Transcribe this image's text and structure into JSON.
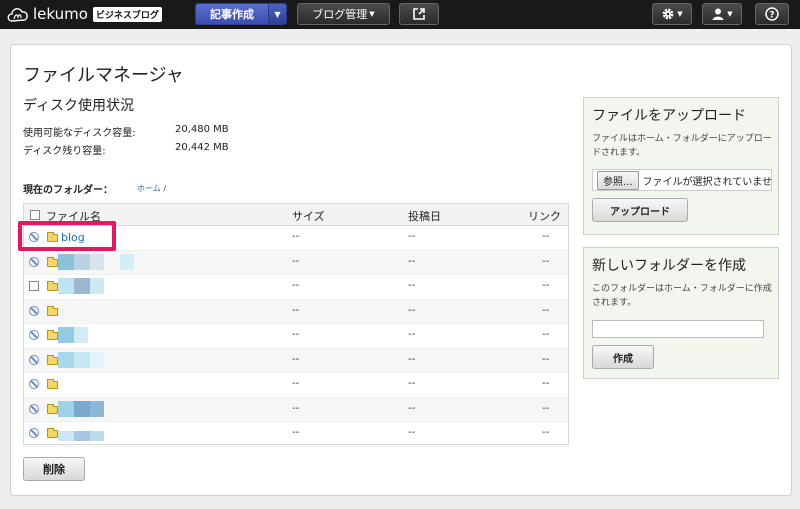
{
  "topbar": {
    "logo_text": "lekumo",
    "logo_badge": "ビジネスブログ",
    "post_label": "記事作成",
    "blog_manage_label": "ブログ管理",
    "icons": [
      "external-link-icon",
      "gear-icon",
      "user-icon",
      "help-icon"
    ]
  },
  "page": {
    "title": "ファイルマネージャ",
    "disk_title": "ディスク使用状況",
    "disk": [
      {
        "label": "使用可能なディスク容量:",
        "value": "20,480 MB"
      },
      {
        "label": "ディスク残り容量:",
        "value": "20,442 MB"
      }
    ],
    "folder_label": "現在のフォルダー：",
    "breadcrumb": "ホーム",
    "breadcrumb_sep": "/"
  },
  "table": {
    "headers": {
      "name": "ファイル名",
      "size": "サイズ",
      "date": "投稿日",
      "link": "リンク"
    },
    "rows": [
      {
        "name": "blog",
        "size": "--",
        "date": "--",
        "link": "--"
      },
      {
        "name": "",
        "size": "--",
        "date": "--",
        "link": "--"
      },
      {
        "name": "",
        "size": "--",
        "date": "--",
        "link": "--"
      },
      {
        "name": "",
        "size": "--",
        "date": "--",
        "link": "--"
      },
      {
        "name": "",
        "size": "--",
        "date": "--",
        "link": "--"
      },
      {
        "name": "",
        "size": "--",
        "date": "--",
        "link": "--"
      },
      {
        "name": "",
        "size": "--",
        "date": "--",
        "link": "--"
      },
      {
        "name": "",
        "size": "--",
        "date": "--",
        "link": "--"
      },
      {
        "name": "",
        "size": "--",
        "date": "--",
        "link": "--"
      }
    ],
    "delete_label": "削除"
  },
  "upload": {
    "title": "ファイルをアップロード",
    "desc": "ファイルはホーム・フォルダーにアップロードされます。",
    "browse_label": "参照...",
    "file_status": "ファイルが選択されていませ",
    "button_label": "アップロード"
  },
  "new_folder": {
    "title": "新しいフォルダーを作成",
    "desc": "このフォルダーはホーム・フォルダーに作成されます。",
    "button_label": "作成"
  },
  "colors": {
    "topbar": "#191919",
    "post_button": "#3f54b8",
    "link": "#1f6fb5",
    "highlight": "#e8175d",
    "side_box": "#f3f6ee"
  }
}
